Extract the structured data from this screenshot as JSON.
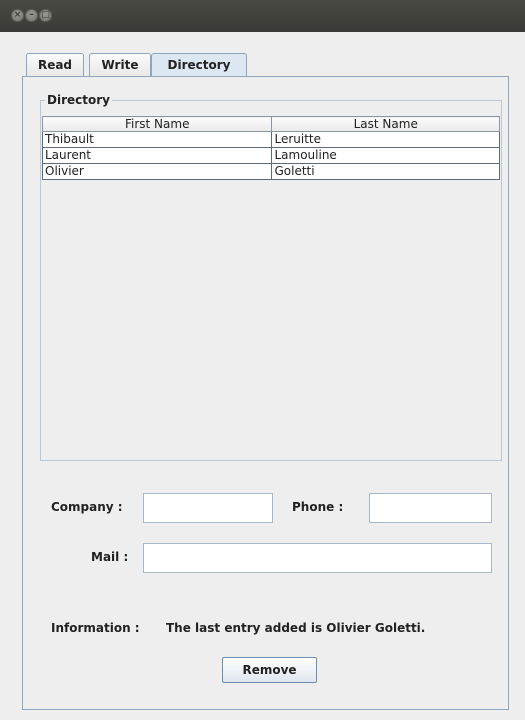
{
  "window": {
    "buttons": [
      "×",
      "–",
      "□"
    ]
  },
  "tabs": [
    {
      "label": "Read",
      "active": false
    },
    {
      "label": "Write",
      "active": false
    },
    {
      "label": "Directory",
      "active": true
    }
  ],
  "directory": {
    "title": "Directory",
    "columns": [
      "First Name",
      "Last Name"
    ],
    "rows": [
      [
        "Thibault",
        "Leruitte"
      ],
      [
        "Laurent",
        "Lamouline"
      ],
      [
        "Olivier",
        "Goletti"
      ]
    ]
  },
  "form": {
    "company_label": "Company :",
    "company_value": "",
    "phone_label": "Phone :",
    "phone_value": "",
    "mail_label": "Mail :",
    "mail_value": ""
  },
  "info": {
    "label": "Information :",
    "text": "The last entry added is Olivier Goletti."
  },
  "actions": {
    "remove_label": "Remove"
  },
  "colors": {
    "tab_border": "#8fa4bd",
    "active_tab": "#dde7f1"
  }
}
